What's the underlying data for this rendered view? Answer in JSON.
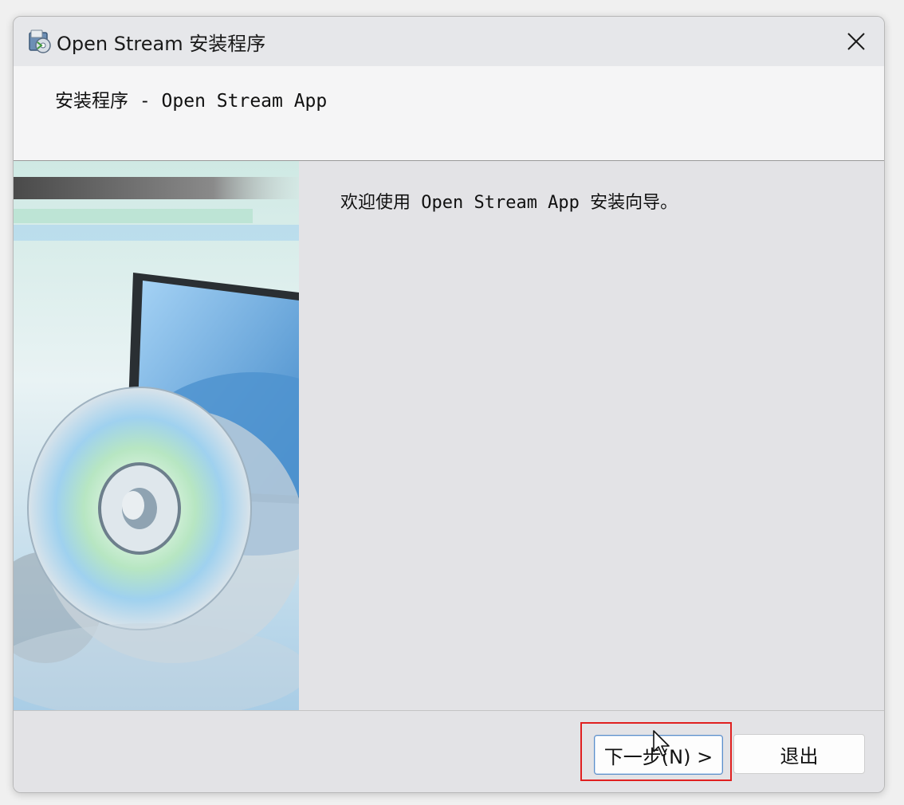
{
  "window": {
    "title": "Open Stream 安装程序",
    "icon": "installer-package-icon",
    "close_glyph": "✕"
  },
  "header": {
    "title": "安装程序 - Open Stream App"
  },
  "content": {
    "welcome_text": "欢迎使用 Open Stream App 安装向导。",
    "side_image": "cd-disc-monitor-illustration"
  },
  "footer": {
    "next_label": "下一步(N) >",
    "exit_label": "退出"
  },
  "annotation": {
    "highlight_color": "#e02020"
  },
  "colors": {
    "accent": "#5b8ec9",
    "dialog_bg": "#e3e3e6",
    "header_bg": "#f5f5f6"
  }
}
